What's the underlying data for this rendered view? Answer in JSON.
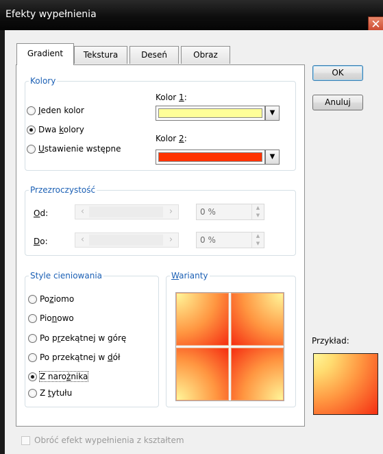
{
  "window": {
    "title": "Efekty wypełnienia",
    "close_label": "✕"
  },
  "tabs": [
    {
      "label": "Gradient",
      "active": true
    },
    {
      "label": "Tekstura",
      "active": false
    },
    {
      "label": "Deseń",
      "active": false
    },
    {
      "label": "Obraz",
      "active": false
    }
  ],
  "colors_group": {
    "legend": "Kolory",
    "options": [
      {
        "pre": "",
        "key": "J",
        "post": "eden kolor",
        "selected": false
      },
      {
        "pre": "Dwa ",
        "key": "k",
        "post": "olory",
        "selected": true
      },
      {
        "pre": "",
        "key": "U",
        "post": "stawienie wstępne",
        "selected": false
      }
    ],
    "color1": {
      "pre": "Kolor ",
      "key": "1",
      "post": ":",
      "value": "#ffff99"
    },
    "color2": {
      "pre": "Kolor ",
      "key": "2",
      "post": ":",
      "value": "#ff3300"
    }
  },
  "transparency": {
    "legend": "Przezroczystość",
    "from_key": "O",
    "from_post": "d:",
    "from_value": "0 %",
    "to_key": "D",
    "to_post": "o:",
    "to_value": "0 %"
  },
  "shading": {
    "legend": "Style cieniowania",
    "options": [
      {
        "pre": "Po",
        "key": "z",
        "post": "iomo",
        "selected": false
      },
      {
        "pre": "Pio",
        "key": "n",
        "post": "owo",
        "selected": false
      },
      {
        "pre": "Po p",
        "key": "r",
        "post": "zekątnej w górę",
        "selected": false
      },
      {
        "pre": "Po przekątnej w ",
        "key": "d",
        "post": "ół",
        "selected": false
      },
      {
        "pre": "Z naro",
        "key": "ż",
        "post": "nika",
        "selected": true
      },
      {
        "pre": "Z ",
        "key": "t",
        "post": "ytułu",
        "selected": false
      }
    ]
  },
  "variants": {
    "key": "W",
    "post": "arianty"
  },
  "buttons": {
    "ok": "OK",
    "cancel": "Anuluj"
  },
  "preview": {
    "label": "Przykład:"
  },
  "rotate_checkbox": {
    "label": "Obróć efekt wypełnienia z kształtem",
    "checked": false,
    "enabled": false
  }
}
